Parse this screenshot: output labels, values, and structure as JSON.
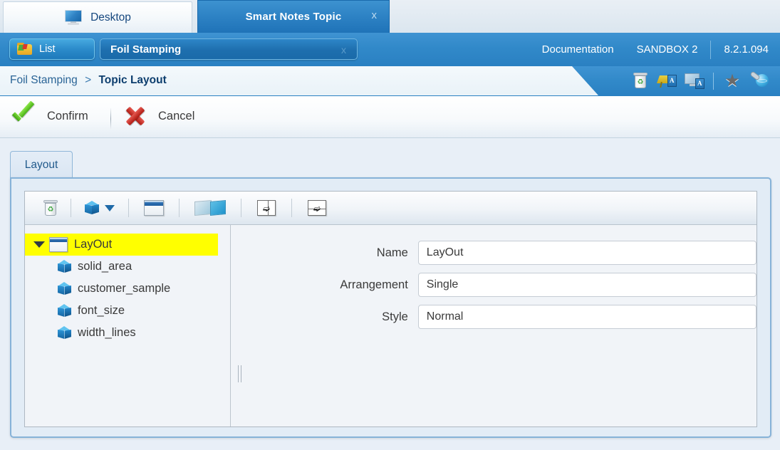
{
  "window_tabs": [
    {
      "label": "Desktop",
      "icon": "monitor-icon",
      "active": false
    },
    {
      "label": "Smart Notes Topic",
      "icon": "",
      "active": true,
      "close": "x"
    }
  ],
  "header": {
    "list_button": {
      "label": "List",
      "icon": "folder-icon"
    },
    "document_chip": {
      "label": "Foil Stamping",
      "close": "x"
    },
    "links": [
      "Documentation",
      "SANDBOX 2"
    ],
    "version": "8.2.1.094"
  },
  "breadcrumb": {
    "root": "Foil Stamping",
    "separator": ">",
    "current": "Topic Layout"
  },
  "header_icons": [
    {
      "name": "recycle-bin-icon"
    },
    {
      "name": "note-annotation-icon"
    },
    {
      "name": "screen-annotation-icon"
    },
    {
      "name": "favorite-star-icon"
    },
    {
      "name": "globe-link-icon"
    }
  ],
  "actions": [
    {
      "label": "Confirm",
      "icon": "green-check-icon"
    },
    {
      "label": "Cancel",
      "icon": "red-x-icon"
    }
  ],
  "panel": {
    "tab_label": "Layout",
    "toolbar": [
      {
        "name": "delete-icon"
      },
      {
        "name": "add-element-icon"
      },
      {
        "name": "add-element-dropdown-caret"
      },
      {
        "name": "window-layout-icon"
      },
      {
        "name": "two-pane-layout-icon"
      },
      {
        "name": "split-vertical-icon"
      },
      {
        "name": "split-horizontal-icon"
      }
    ]
  },
  "tree": {
    "root": {
      "label": "LayOut",
      "icon": "window-node-icon",
      "selected": true,
      "expanded": true
    },
    "children": [
      {
        "label": "solid_area",
        "icon": "cube-node-icon"
      },
      {
        "label": "customer_sample",
        "icon": "cube-node-icon"
      },
      {
        "label": "font_size",
        "icon": "cube-node-icon"
      },
      {
        "label": "width_lines",
        "icon": "cube-node-icon"
      }
    ]
  },
  "form": {
    "name": {
      "label": "Name",
      "value": "LayOut",
      "placeholder": ""
    },
    "arrangement": {
      "label": "Arrangement",
      "value": "Single"
    },
    "style": {
      "label": "Style",
      "value": "Normal"
    }
  },
  "colors": {
    "header_blue": "#3189c9",
    "active_tab_blue": "#2d82c4",
    "selection_yellow": "#ffff00",
    "panel_border": "#86b2d8",
    "link_text": "#ffffff"
  }
}
